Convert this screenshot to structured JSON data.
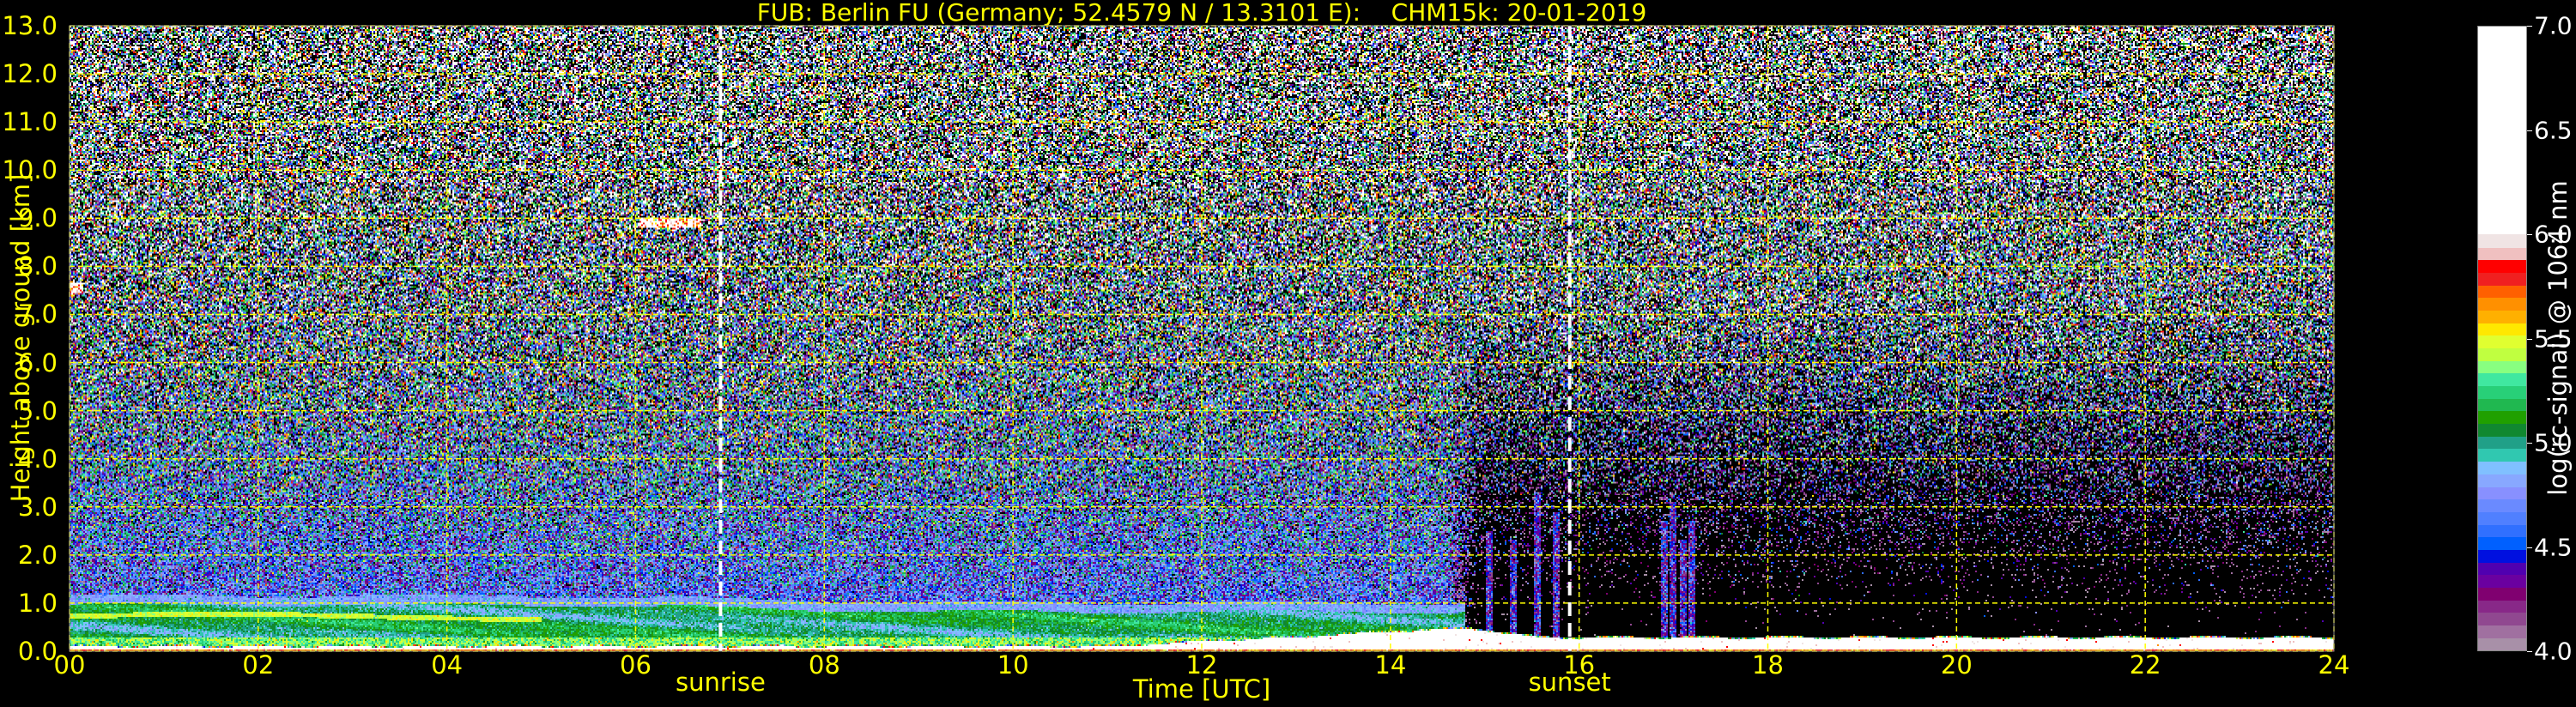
{
  "title": "FUB: Berlin FU (Germany; 52.4579 N / 13.3101 E):    CHM15k: 20-01-2019",
  "chart_data": {
    "type": "heatmap",
    "xlabel": "Time [UTC]",
    "ylabel": "Height above ground [km]",
    "xlim": [
      0,
      24
    ],
    "ylim": [
      0,
      13
    ],
    "x_ticks": [
      "00",
      "02",
      "04",
      "06",
      "08",
      "10",
      "12",
      "14",
      "16",
      "18",
      "20",
      "22",
      "24"
    ],
    "y_ticks": [
      "0.0",
      "1.0",
      "2.0",
      "3.0",
      "4.0",
      "5.0",
      "6.0",
      "7.0",
      "8.0",
      "9.0",
      "10.0",
      "11.0",
      "12.0",
      "13.0"
    ],
    "grid": true,
    "grid_color": "#ffff00",
    "text_color": "#ffff00",
    "annotations": [
      {
        "label": "sunrise",
        "time_h": 6.9
      },
      {
        "label": "sunset",
        "time_h": 15.9
      }
    ],
    "features": {
      "boundary_layer_top_km": 1.1,
      "clouds": [
        {
          "t_start_h": 6.05,
          "t_end_h": 6.7,
          "height_km": 8.9
        },
        {
          "t_start_h": 0.0,
          "t_end_h": 0.15,
          "height_km": 7.55
        }
      ],
      "night_transition_h": 14.8
    },
    "colorbar": {
      "label": "log(rc-signal) @ 1064 nm",
      "range": [
        4.0,
        7.0
      ],
      "ticks": [
        "4.0",
        "4.5",
        "5.0",
        "5.5",
        "6.0",
        "6.5",
        "7.0"
      ],
      "colors": [
        "#a890a8",
        "#a070a0",
        "#904890",
        "#882888",
        "#800070",
        "#6a00a0",
        "#5000b0",
        "#0010e0",
        "#0060ff",
        "#3070ff",
        "#5080ff",
        "#6a8aff",
        "#8890ff",
        "#88a8ff",
        "#80c0ff",
        "#30c8b0",
        "#20a088",
        "#108830",
        "#20a000",
        "#20b850",
        "#28d078",
        "#40e8a0",
        "#88ff80",
        "#c0ff40",
        "#e0ff30",
        "#ffe800",
        "#ffb000",
        "#ff9000",
        "#ff6000",
        "#f02020",
        "#ff0000",
        "#f0c0c0",
        "#f0e4e4"
      ],
      "saturation_color": "#ffffff"
    }
  }
}
